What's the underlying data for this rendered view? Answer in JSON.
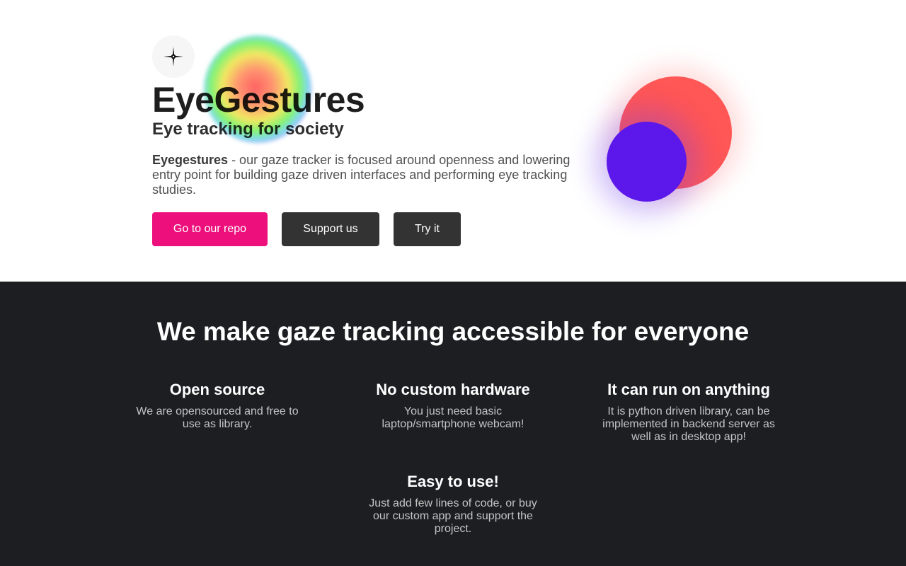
{
  "hero": {
    "logo_icon": "crosshair-sparkle-icon",
    "title": "EyeGestures",
    "subtitle": "Eye tracking for society",
    "description_bold": "Eyegestures",
    "description_rest": " - our gaze tracker is focused around openness and lowering entry point for building gaze driven interfaces and performing eye tracking studies.",
    "buttons": {
      "repo": "Go to our repo",
      "support": "Support us",
      "try": "Try it"
    }
  },
  "colors": {
    "accent_pink": "#ed0f7c",
    "button_dark": "#333333",
    "circle_red": "#ff5656",
    "circle_violet": "#5c18ea",
    "section_dark": "#1d1e22"
  },
  "section": {
    "title": "We make gaze tracking accessible for everyone",
    "features": [
      {
        "title": "Open source",
        "text": "We are opensourced and free to use as library."
      },
      {
        "title": "No custom hardware",
        "text": "You just need basic laptop/smartphone webcam!"
      },
      {
        "title": "It can run on anything",
        "text": "It is python driven library, can be implemented in backend server as well as in desktop app!"
      },
      {
        "title": "Easy to use!",
        "text": "Just add few lines of code, or buy our custom app and support the project."
      }
    ]
  }
}
